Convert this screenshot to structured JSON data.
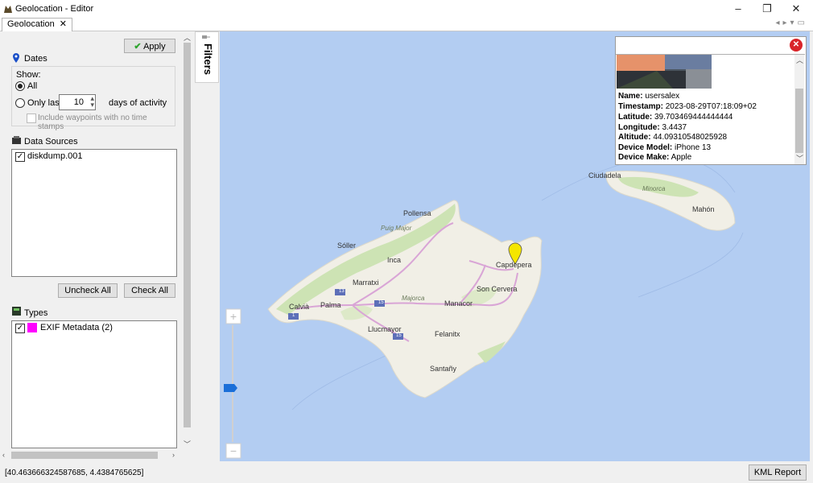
{
  "window": {
    "title": "Geolocation - Editor",
    "minimize": "–",
    "maximize": "❐",
    "close": "✕"
  },
  "tab": {
    "label": "Geolocation",
    "close": "✕"
  },
  "left": {
    "apply_label": "Apply",
    "dates": {
      "heading": "Dates",
      "show_label": "Show:",
      "all_label": "All",
      "only_last_label": "Only last",
      "days_value": "10",
      "days_suffix": "days of activity",
      "include_waypoints_label": "Include waypoints with no time stamps"
    },
    "data_sources": {
      "heading": "Data Sources",
      "items": [
        {
          "label": "diskdump.001",
          "checked": true
        }
      ]
    },
    "uncheck_all_label": "Uncheck All",
    "check_all_label": "Check All",
    "types": {
      "heading": "Types",
      "items": [
        {
          "label": "EXIF Metadata (2)",
          "checked": true,
          "color": "#ff00ff"
        }
      ]
    }
  },
  "filters_label": "Filters",
  "map": {
    "places": [
      "Pollensa",
      "Puig Major",
      "Sóller",
      "Inca",
      "Capdepera",
      "Marratxi",
      "Son Cervera",
      "Calvià",
      "Palma",
      "Majorca",
      "Manacor",
      "Llucmayor",
      "Felanitx",
      "Santañy",
      "Ciudadela",
      "Minorca",
      "Mahón"
    ],
    "road_labels": [
      "13",
      "15",
      "1",
      "15"
    ],
    "zoom_in": "+",
    "zoom_out": "−"
  },
  "popup": {
    "close": "✕",
    "name_label": "Name:",
    "name": "usersalex",
    "timestamp_label": "Timestamp:",
    "timestamp": "2023-08-29T07:18:09+02",
    "latitude_label": "Latitude:",
    "latitude": "39.703469444444444",
    "longitude_label": "Longitude:",
    "longitude": "3.4437",
    "altitude_label": "Altitude:",
    "altitude": "44.09310548025928",
    "model_label": "Device Model:",
    "model": "iPhone 13",
    "make_label": "Device Make:",
    "make": "Apple"
  },
  "status": {
    "coords": "[40.463666324587685, 4.4384765625]",
    "kml_label": "KML Report"
  },
  "colors": {
    "accent": "#1a6ed8",
    "marker": "#f5e600",
    "land": "#f1efe6",
    "forest": "#cde3b4",
    "sea": "#b3cdf2",
    "road": "#d9a5d6"
  }
}
